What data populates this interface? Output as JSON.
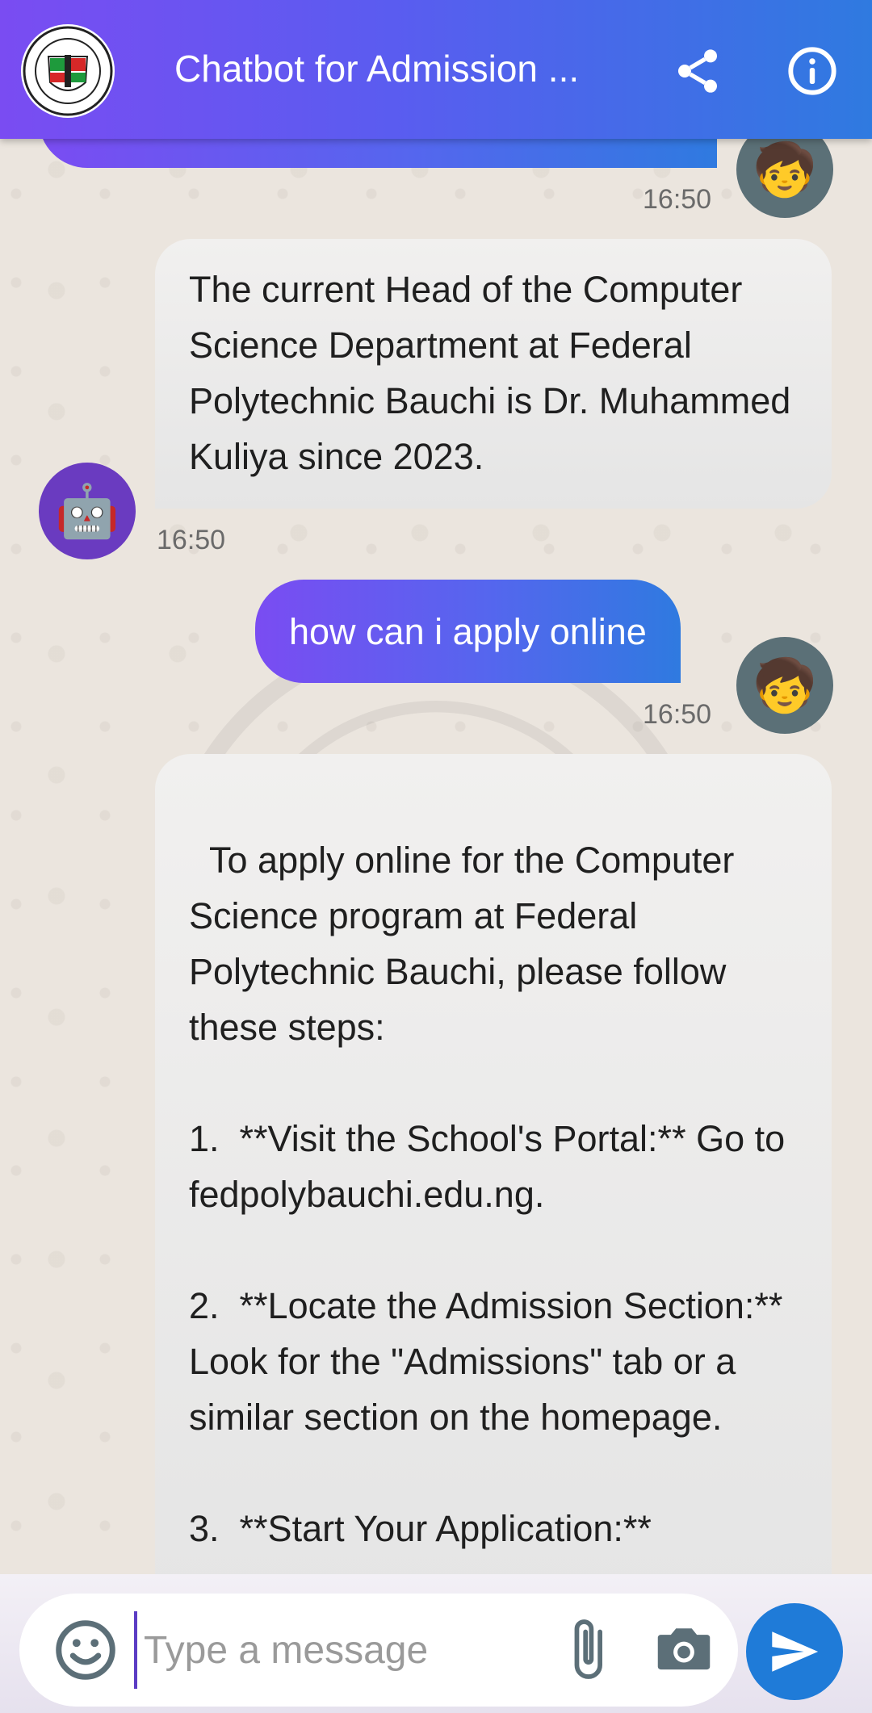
{
  "header": {
    "title": "Chatbot for Admission ...",
    "logo_icon": "federal-polytechnic-bauchi-logo",
    "share_icon": "share-icon",
    "info_icon": "info-icon"
  },
  "messages": [
    {
      "sender": "user",
      "text": "",
      "time": "16:50"
    },
    {
      "sender": "bot",
      "text": "The current Head of the Computer Science Department at Federal Polytechnic Bauchi is Dr. Muhammed Kuliya since 2023.",
      "time": "16:50"
    },
    {
      "sender": "user",
      "text": "how can i apply online",
      "time": "16:50"
    },
    {
      "sender": "bot",
      "text": "To apply online for the Computer Science program at Federal Polytechnic Bauchi, please follow these steps:\n\n1.  **Visit the School's Portal:** Go to fedpolybauchi.edu.ng.\n\n2.  **Locate the Admission Section:** Look for the \"Admissions\" tab or a similar section on the homepage.\n\n3.  **Start Your Application:**",
      "time": ""
    }
  ],
  "composer": {
    "placeholder": "Type a message",
    "value": ""
  },
  "avatars": {
    "user": "🧒",
    "bot": "🤖"
  },
  "colors": {
    "accent_start": "#7a4cf2",
    "accent_end": "#2f7ae0",
    "send_button": "#1f7bd8",
    "bot_avatar": "#6a3bc0",
    "user_avatar": "#5b7077"
  }
}
